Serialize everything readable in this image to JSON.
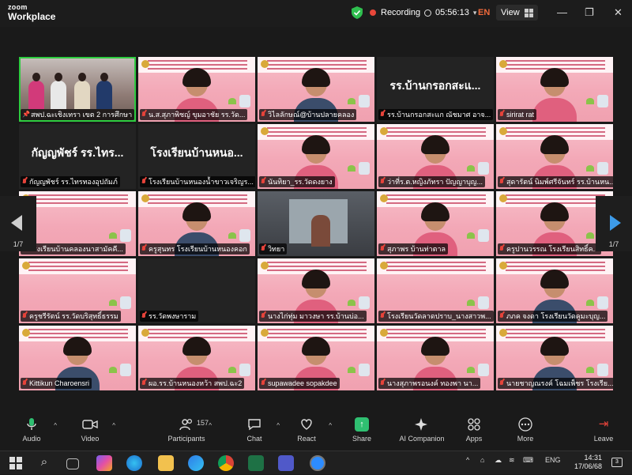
{
  "window": {
    "brand_line1": "zoom",
    "brand_line2": "Workplace",
    "recording_label": "Recording",
    "timer": "05:56:13",
    "language": "EN",
    "view_label": "View"
  },
  "gallery": {
    "page_left": "1/7",
    "page_right": "1/7",
    "tiles": [
      {
        "name": "สพป.ฉะเชิงเทรา เขต 2 การศึกษา",
        "style": "room",
        "active": true,
        "muted": false
      },
      {
        "name": "น.ส.สุภาพิชญ์ ขุมอาชัย รร.วัด...",
        "style": "pink",
        "avatar": "woman"
      },
      {
        "name": "วิไลลักษณ์@บ้านปลายคลอง",
        "style": "pink",
        "avatar": "man"
      },
      {
        "name": "รร.บ้านกรอกสะแก ณัชมาศ อาจ...",
        "style": "black",
        "big": "รร.บ้านกรอกสะแ..."
      },
      {
        "name": "sirirat rat",
        "style": "pink",
        "avatar": "woman"
      },
      {
        "name": "กัญญพัชร์ รร.ไทรทองอุปถัมภ์",
        "style": "black",
        "big": "กัญญพัชร์ รร.ไทร..."
      },
      {
        "name": "โรงเรียนบ้านหนองน้ำขาวเจริญร...",
        "style": "black",
        "big": "โรงเรียนบ้านหนอ..."
      },
      {
        "name": "นันทิยา_รร.วัดดงยาง",
        "style": "pink",
        "avatar": "woman"
      },
      {
        "name": "ว่าที่ร.ต.หญิงภัทรา ปัญญาบุญ...",
        "style": "pink",
        "avatar": "woman"
      },
      {
        "name": "สุดารัตน์ นิมพ์ศรีจันทร์ รร.บ้านหน...",
        "style": "pink",
        "avatar": "woman"
      },
      {
        "name": "โรงเรียนบ้านคลองนาสามัคคี...",
        "style": "pink",
        "avatar": "none"
      },
      {
        "name": "ครูสุนทร โรงเรียนบ้านหนองคอก",
        "style": "pink",
        "avatar": "man"
      },
      {
        "name": "วิทยา",
        "style": "cam",
        "avatar": "none"
      },
      {
        "name": "สุภาพร บ้านท่าตาล",
        "style": "pink",
        "avatar": "woman"
      },
      {
        "name": "ครูปานวรรณ โรงเรียนสิทธิ์ค...",
        "style": "pink",
        "avatar": "woman"
      },
      {
        "name": "ครูชรีรัตน์ รร.วัดบริสุทธิ์ธรรม",
        "style": "pink",
        "avatar": "none"
      },
      {
        "name": "รร.วัดพงษาราม",
        "style": "black",
        "big": ""
      },
      {
        "name": "นางไก่ทุ่ม มาวงษา รร.บ้านบ่อ...",
        "style": "pink",
        "avatar": "woman"
      },
      {
        "name": "โรงเรียนวัดลาดปราบ_นางสาวพ...",
        "style": "pink",
        "avatar": "none"
      },
      {
        "name": "ภภค จงดา โรงเรียนวัดคูมะบุญ...",
        "style": "pink",
        "avatar": "man"
      },
      {
        "name": "Kittikun Charoensri",
        "style": "pink",
        "avatar": "man"
      },
      {
        "name": "ผอ.รร.บ้านหนองหว้า สพป.ฉะ2",
        "style": "pink",
        "avatar": "woman"
      },
      {
        "name": "supawadee sopakdee",
        "style": "pink",
        "avatar": "woman"
      },
      {
        "name": "นางสุภาพรอนงค์ ทองพา นา...",
        "style": "pink",
        "avatar": "woman"
      },
      {
        "name": "นายชาญณรงค์ โฉมเพ็ชร โรงเรีย...",
        "style": "pink",
        "avatar": "man"
      }
    ]
  },
  "toolbar": {
    "audio": "Audio",
    "video": "Video",
    "participants": "Participants",
    "participants_count": "157",
    "chat": "Chat",
    "react": "React",
    "share": "Share",
    "ai": "AI Companion",
    "apps": "Apps",
    "more": "More",
    "leave": "Leave"
  },
  "taskbar": {
    "language": "ENG",
    "time": "14:31",
    "date": "17/06/68",
    "notifications": "3"
  },
  "colors": {
    "recording": "#e8473a",
    "language_accent": "#f06a3b",
    "active_speaker": "#2ecc40",
    "share": "#2fbf71",
    "muted": "#e5433a"
  }
}
